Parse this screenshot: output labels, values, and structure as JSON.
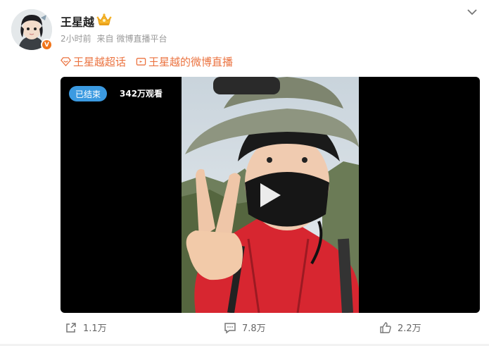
{
  "post": {
    "author": "王星越",
    "time": "2小时前",
    "source_prefix": "来自",
    "source": "微博直播平台",
    "topics": [
      "王星越超话",
      "王星越的微博直播"
    ]
  },
  "video": {
    "status": "已结束",
    "views": "342万观看"
  },
  "actions": {
    "share_count": "1.1万",
    "comment_count": "7.8万",
    "like_count": "2.2万"
  },
  "icons": {
    "verified": "v-badge",
    "crown": "vip-crown-icon",
    "more": "chevron-down-icon",
    "topic1": "supertopic-diamond-icon",
    "topic2": "live-tv-icon",
    "share": "share-icon",
    "comment": "comment-icon",
    "like": "like-icon"
  },
  "colors": {
    "accent": "#eb7340",
    "status_pill": "#3b9ae1",
    "verified_badge": "#f0741a"
  }
}
